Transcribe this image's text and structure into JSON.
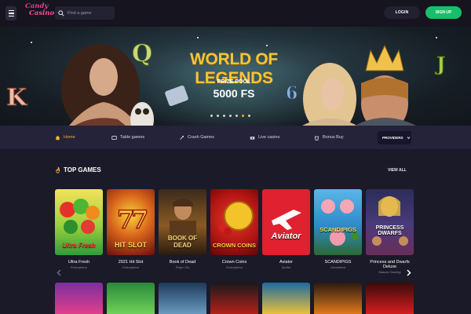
{
  "header": {
    "logo": [
      "Candy",
      "Casino"
    ],
    "search_placeholder": "Find a game",
    "login_label": "LOGIN",
    "signup_label": "SIGN UP"
  },
  "banner": {
    "title": "WORLD OF LEGENDS",
    "prize_label": "PRIZE POOL",
    "prize_value": "5000 FS",
    "slides_count": 7,
    "active_slide": 6
  },
  "nav": {
    "items": [
      {
        "label": "Home",
        "icon": "home-icon",
        "active": true
      },
      {
        "label": "Table games",
        "icon": "table-games-icon",
        "active": false
      },
      {
        "label": "Crash Games",
        "icon": "rocket-icon",
        "active": false
      },
      {
        "label": "Live casino",
        "icon": "live-casino-icon",
        "active": false
      },
      {
        "label": "Bonus Buy",
        "icon": "bonus-buy-icon",
        "active": false
      }
    ],
    "providers_label": "PROVIDERS"
  },
  "top_games": {
    "title": "TOP GAMES",
    "view_all_label": "VIEW ALL",
    "games": [
      {
        "name": "Ultra Fresh",
        "provider": "Endorphina",
        "thumb_text": "Ultra Fresh"
      },
      {
        "name": "2021 Hit Slot",
        "provider": "Endorphina",
        "thumb_text": "HIT SLOT"
      },
      {
        "name": "Book of Dead",
        "provider": "Play'n Go",
        "thumb_text": "BOOK OF DEAD"
      },
      {
        "name": "Crown Coins",
        "provider": "Endorphina",
        "thumb_text": "CROWN COINS"
      },
      {
        "name": "Aviator",
        "provider": "Spribe",
        "thumb_text": "Aviator"
      },
      {
        "name": "SCANDIPIGS",
        "provider": "Gamebeat",
        "thumb_text": "SCANDIPIGS"
      },
      {
        "name": "Princess and Dwarfs Deluxe",
        "provider": "Mascot Gaming",
        "thumb_text": "PRINCESS DWARFS"
      }
    ]
  },
  "colors": {
    "accent_orange": "#f5b13b",
    "signup_green": "#18bf6b",
    "background": "#1b1a29",
    "nav_bg": "#24233a"
  }
}
